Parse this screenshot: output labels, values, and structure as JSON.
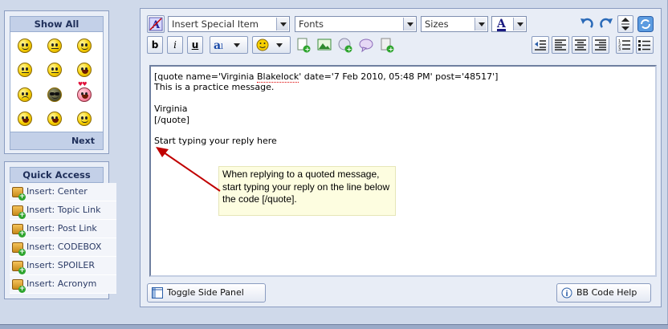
{
  "smiley_panel": {
    "title": "Show All",
    "next": "Next"
  },
  "smileys": [
    "smile",
    "wink",
    "grin",
    "neutral",
    "confused",
    "eyes",
    "angry",
    "cool",
    "love",
    "surprised",
    "big-grin",
    "tongue"
  ],
  "quick_access": {
    "title": "Quick Access",
    "items": [
      "Insert: Center",
      "Insert: Topic Link",
      "Insert: Post Link",
      "Insert: CODEBOX",
      "Insert: SPOILER",
      "Insert: Acronym"
    ]
  },
  "toolbar": {
    "special_item": "Insert Special Item",
    "fonts": "Fonts",
    "sizes": "Sizes",
    "bold": "b",
    "italic": "i",
    "underline": "u",
    "font_color_letter": "A"
  },
  "editor": {
    "line1_pre": "[quote name='Virginia ",
    "line1_spell": "Blakelock",
    "line1_post": "' date='7 Feb 2010, 05:48 PM' post='48517']",
    "line2": "This is a practice message.",
    "line3": "Virginia",
    "line4": "[/quote]",
    "line5": "Start typing your reply here"
  },
  "annotation": "When replying to a quoted message, start typing your reply on the line below the code [/quote].",
  "buttons": {
    "toggle_side_panel": "Toggle Side Panel",
    "bb_code_help": "BB Code Help"
  },
  "colors": {
    "frame": "#cfd9ea",
    "panel_head": "#c3d0e8",
    "arrow": "#c00000",
    "note_bg": "#fdfde0"
  }
}
